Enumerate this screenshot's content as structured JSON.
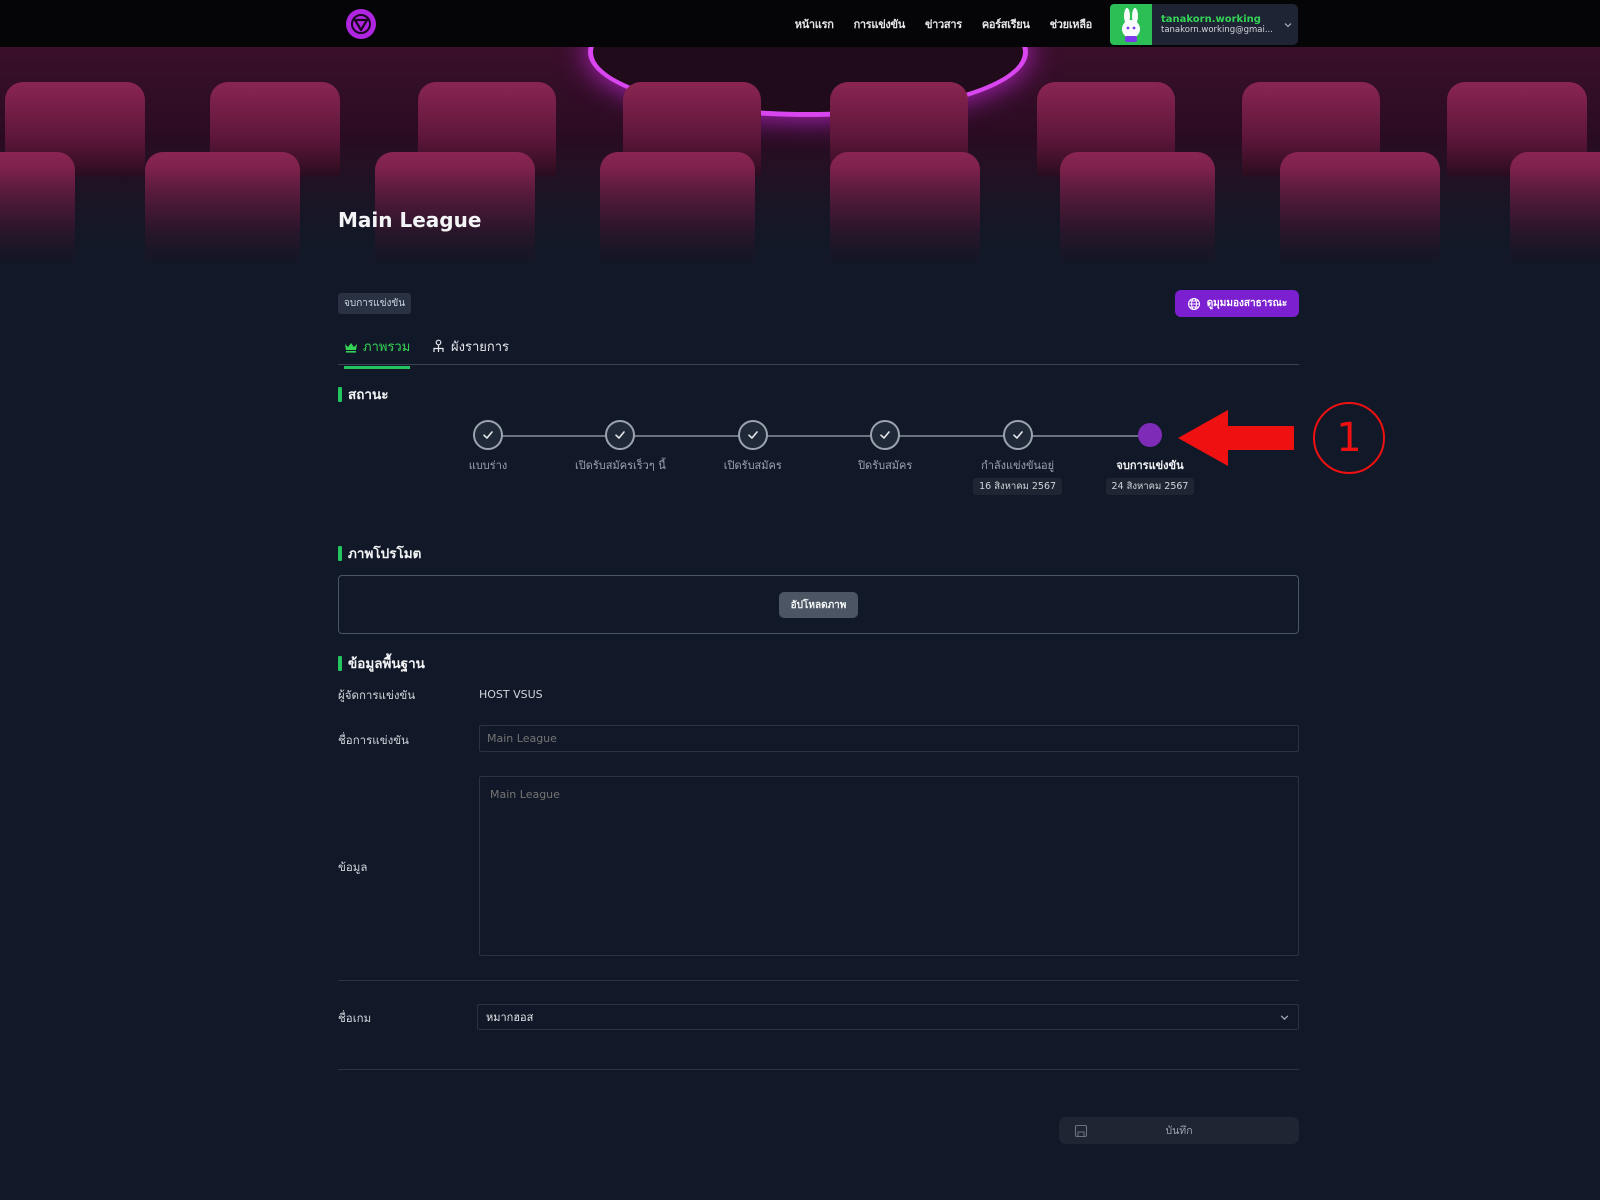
{
  "nav": {
    "links": [
      "หน้าแรก",
      "การแข่งขัน",
      "ข่าวสาร",
      "คอร์สเรียน",
      "ช่วยเหลือ"
    ],
    "user_name": "tanakorn.working",
    "user_email": "tanakorn.working@gmai..."
  },
  "page": {
    "title": "Main League"
  },
  "status_chip": "จบการแข่งขัน",
  "public_button": "ดูมุมมองสาธารณะ",
  "tabs": [
    {
      "label": "ภาพรวม",
      "icon": "crown-icon",
      "active": true
    },
    {
      "label": "ผังรายการ",
      "icon": "bracket-icon",
      "active": false
    }
  ],
  "sections": {
    "status": "สถานะ",
    "promo": "ภาพโปรโมต",
    "basic_info": "ข้อมูลพื้นฐาน"
  },
  "stepper": {
    "steps": [
      {
        "label": "แบบร่าง",
        "date": "",
        "state": "done"
      },
      {
        "label": "เปิดรับสมัครเร็วๆ นี้",
        "date": "",
        "state": "done"
      },
      {
        "label": "เปิดรับสมัคร",
        "date": "",
        "state": "done"
      },
      {
        "label": "ปิดรับสมัคร",
        "date": "",
        "state": "done"
      },
      {
        "label": "กำลังแข่งขันอยู่",
        "date": "16 สิงหาคม 2567",
        "state": "done"
      },
      {
        "label": "จบการแข่งขัน",
        "date": "24 สิงหาคม 2567",
        "state": "current"
      }
    ]
  },
  "annotation": {
    "number": "1",
    "color": "#ef1111"
  },
  "upload": {
    "button": "อัปโหลดภาพ"
  },
  "form": {
    "organizer_label": "ผู้จัดการแข่งขัน",
    "organizer_value": "HOST VSUS",
    "name_label": "ชื่อการแข่งขัน",
    "name_placeholder": "Main League",
    "info_label": "ข้อมูล",
    "info_placeholder": "Main League",
    "game_label": "ชื่อเกม",
    "game_value": "หมากฮอส",
    "save_label": "บันทึก"
  },
  "colors": {
    "accent_green": "#22c55e",
    "accent_purple": "#7c1fd0",
    "current_step": "#7e2bb8"
  }
}
